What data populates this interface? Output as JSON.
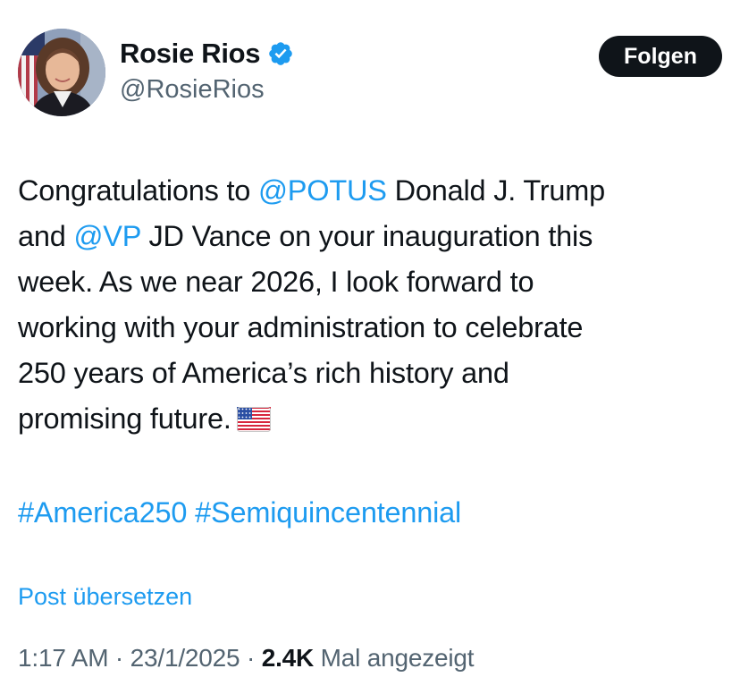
{
  "user": {
    "display_name": "Rosie Rios",
    "handle": "@RosieRios",
    "verified_icon": "verified-badge-icon",
    "accent_color": "#1d9bf0"
  },
  "follow_button": {
    "label": "Folgen"
  },
  "tweet": {
    "lines": [
      [
        {
          "type": "text",
          "text": "Congratulations to "
        },
        {
          "type": "mention",
          "text": "@POTUS"
        },
        {
          "type": "text",
          "text": " Donald J. Trump"
        }
      ],
      [
        {
          "type": "text",
          "text": "and "
        },
        {
          "type": "mention",
          "text": "@VP"
        },
        {
          "type": "text",
          "text": " JD Vance on your inauguration this"
        }
      ],
      [
        {
          "type": "text",
          "text": "week. As we near 2026, I look forward to"
        }
      ],
      [
        {
          "type": "text",
          "text": "working with your administration to celebrate"
        }
      ],
      [
        {
          "type": "text",
          "text": "250 years of America’s rich history and"
        }
      ],
      [
        {
          "type": "text",
          "text": "promising future."
        }
      ]
    ],
    "emoji": "us-flag-icon",
    "hashtags": [
      "#America250",
      "#Semiquincentennial"
    ]
  },
  "translate_label": "Post übersetzen",
  "meta": {
    "time": "1:17 AM",
    "separator": " · ",
    "date": "23/1/2025",
    "views_count": "2.4K",
    "views_label": " Mal angezeigt"
  }
}
